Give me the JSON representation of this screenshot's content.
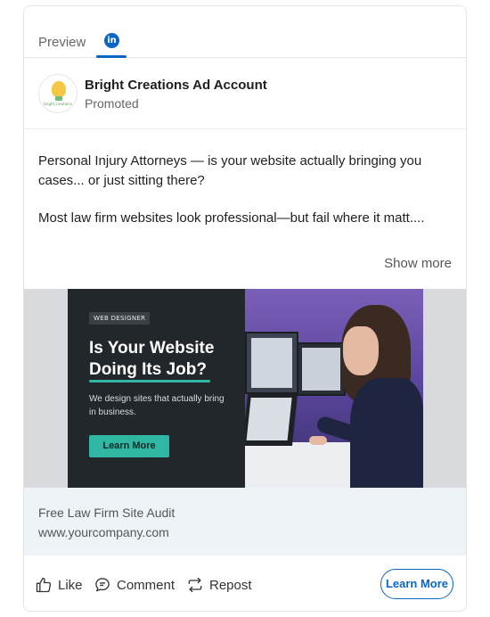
{
  "tabs": {
    "preview_label": "Preview",
    "linkedin_icon_text": "in"
  },
  "post": {
    "account_name": "Bright Creations Ad Account",
    "account_sub": "Promoted",
    "avatar_text": "bright creations",
    "body_para1": "Personal Injury Attorneys — is your website actually bringing you cases... or just sitting there?",
    "body_para2": "Most law firm websites look professional—but fail where it matt....",
    "show_more": "Show more"
  },
  "creative": {
    "badge": "WEB DESIGNER",
    "headline": "Is Your Website Doing Its Job?",
    "subtext": "We design sites that actually bring in business.",
    "button": "Learn More"
  },
  "cta": {
    "title": "Free Law Firm Site Audit",
    "url": "www.yourcompany.com",
    "button": "Learn More"
  },
  "actions": {
    "like": "Like",
    "comment": "Comment",
    "repost": "Repost"
  },
  "colors": {
    "linkedin_blue": "#0a66c2",
    "teal_accent": "#2fb7a3",
    "cta_background": "#eef3f8"
  }
}
